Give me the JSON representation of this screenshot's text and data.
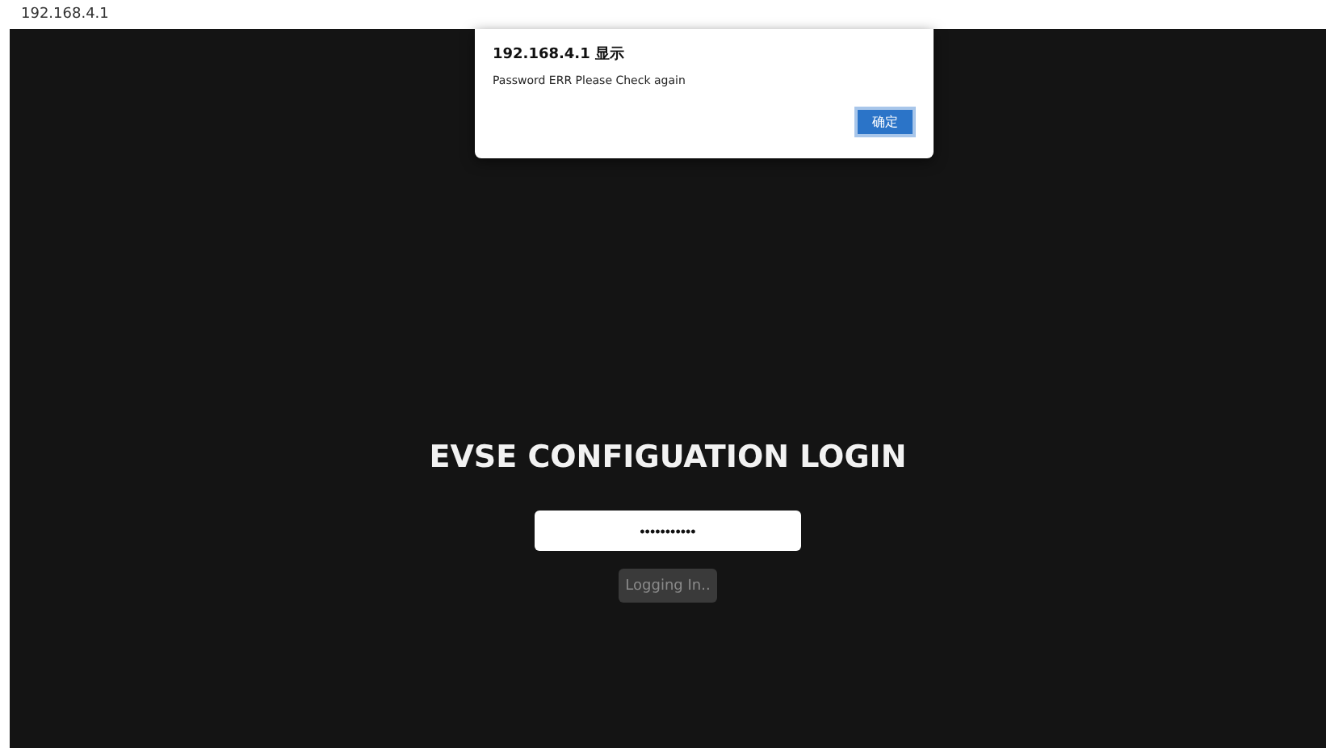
{
  "address_bar": {
    "text": "192.168.4.1"
  },
  "dialog": {
    "title": "192.168.4.1 显示",
    "message": "Password ERR Please Check again",
    "button": "确定"
  },
  "login": {
    "title": "EVSE CONFIGUATION LOGIN",
    "password_value": "•••••••••••",
    "button": {
      "label": "Logging In..",
      "disabled": true
    }
  }
}
